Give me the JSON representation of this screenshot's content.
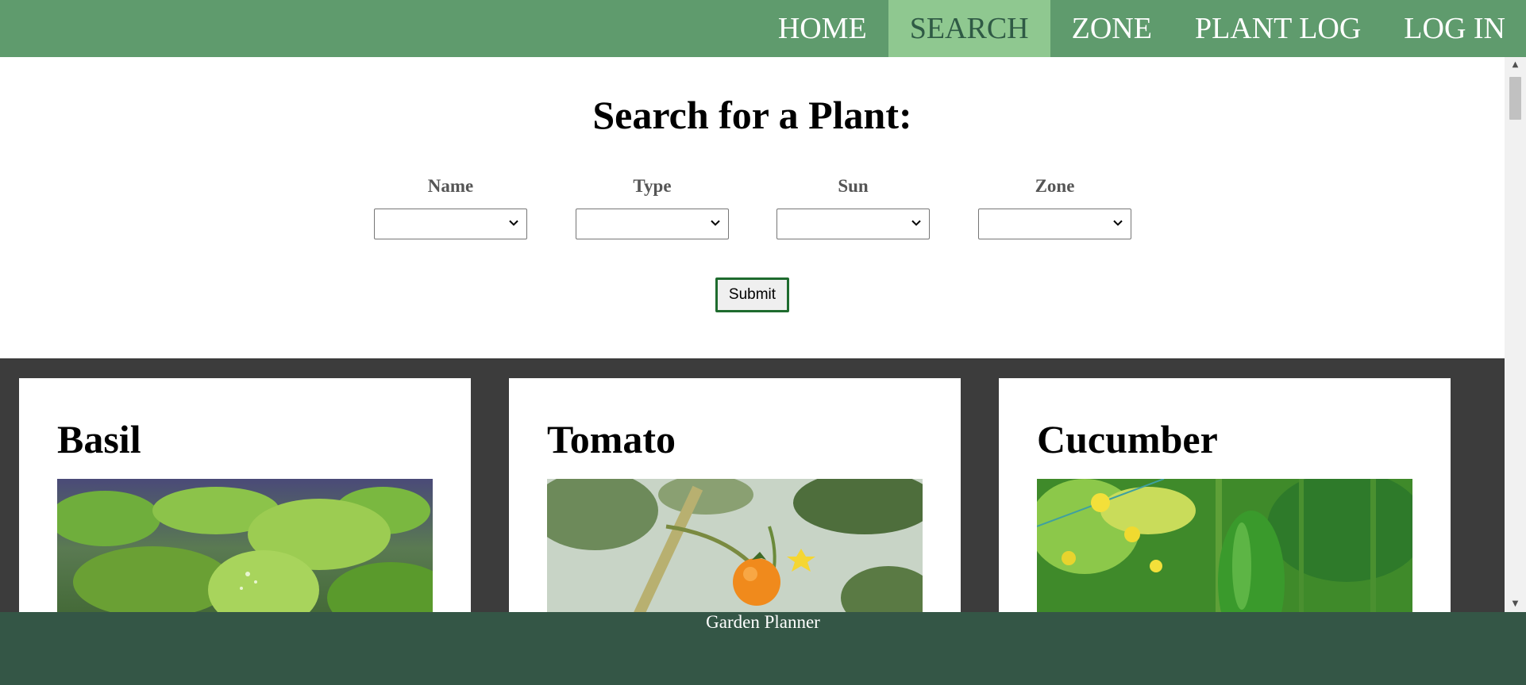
{
  "nav": {
    "items": [
      {
        "label": "HOME",
        "active": false
      },
      {
        "label": "SEARCH",
        "active": true
      },
      {
        "label": "ZONE",
        "active": false
      },
      {
        "label": "PLANT LOG",
        "active": false
      },
      {
        "label": "LOG IN",
        "active": false
      }
    ]
  },
  "search": {
    "title": "Search for a Plant:",
    "fields": [
      {
        "label": "Name",
        "value": ""
      },
      {
        "label": "Type",
        "value": ""
      },
      {
        "label": "Sun",
        "value": ""
      },
      {
        "label": "Zone",
        "value": ""
      }
    ],
    "submit_label": "Submit"
  },
  "plants": [
    {
      "name": "Basil",
      "image": "basil-leaves-photo"
    },
    {
      "name": "Tomato",
      "image": "tomato-vine-photo"
    },
    {
      "name": "Cucumber",
      "image": "cucumber-plant-photo"
    }
  ],
  "footer": {
    "text": "Garden Planner"
  },
  "colors": {
    "nav_bg": "#5f9b6d",
    "nav_active_bg": "#8fc890",
    "cards_bg": "#3c3c3c",
    "footer_bg": "#345646",
    "submit_border": "#1e6b2e"
  }
}
